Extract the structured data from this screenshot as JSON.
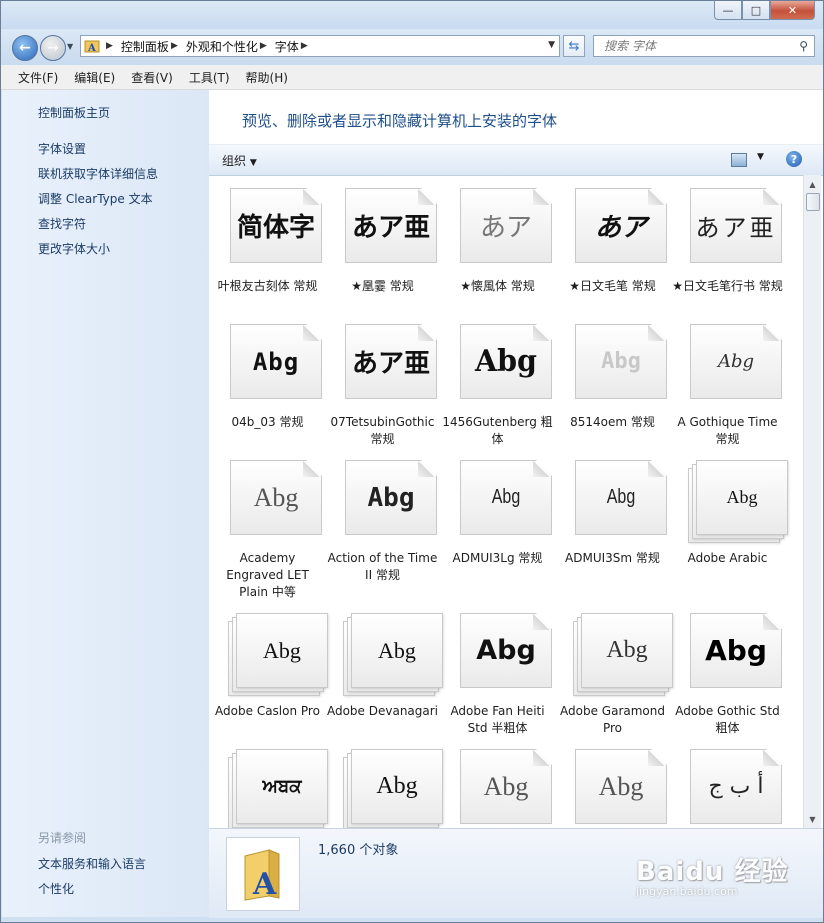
{
  "window": {
    "caption": {
      "minimize": "—",
      "maximize": "□",
      "close": "✕"
    }
  },
  "address": {
    "crumbs": [
      "控制面板",
      "外观和个性化",
      "字体"
    ],
    "search_placeholder": "搜索 字体"
  },
  "menu": [
    "文件(F)",
    "编辑(E)",
    "查看(V)",
    "工具(T)",
    "帮助(H)"
  ],
  "sidebar": {
    "home": "控制面板主页",
    "links": [
      "字体设置",
      "联机获取字体详细信息",
      "调整 ClearType 文本",
      "查找字符",
      "更改字体大小"
    ],
    "see_also_title": "另请参阅",
    "see_also": [
      "文本服务和输入语言",
      "个性化"
    ]
  },
  "main": {
    "title": "预览、删除或者显示和隐藏计算机上安装的字体",
    "organize": "组织"
  },
  "fonts": [
    {
      "sample": "简体字",
      "name": "叶根友古刻体 常规",
      "stacked": false
    },
    {
      "sample": "あア亜",
      "name": "★凰霎 常规",
      "stacked": false
    },
    {
      "sample": "あア",
      "name": "★懐風体 常规",
      "stacked": false
    },
    {
      "sample": "あア",
      "name": "★日文毛笔 常规",
      "stacked": false
    },
    {
      "sample": "あア亜",
      "name": "★日文毛笔行书 常规",
      "stacked": false
    },
    {
      "sample": "Abg",
      "name": "04b_03 常规",
      "stacked": false
    },
    {
      "sample": "あア亜",
      "name": "07TetsubinGothic 常规",
      "stacked": false
    },
    {
      "sample": "Abg",
      "name": "1456Gutenberg 粗体",
      "stacked": false
    },
    {
      "sample": "Abg",
      "name": "8514oem 常规",
      "stacked": false
    },
    {
      "sample": "Abg",
      "name": "A Gothique Time  常规",
      "stacked": false
    },
    {
      "sample": "Abg",
      "name": "Academy Engraved LET Plain 中等",
      "stacked": false
    },
    {
      "sample": "Abg",
      "name": "Action of the Time II 常规",
      "stacked": false
    },
    {
      "sample": "Abg",
      "name": "ADMUI3Lg 常规",
      "stacked": false
    },
    {
      "sample": "Abg",
      "name": "ADMUI3Sm 常规",
      "stacked": false
    },
    {
      "sample": "Abg",
      "name": "Adobe Arabic",
      "stacked": true
    },
    {
      "sample": "Abg",
      "name": "Adobe Caslon Pro",
      "stacked": true
    },
    {
      "sample": "Abg",
      "name": "Adobe Devanagari",
      "stacked": true
    },
    {
      "sample": "Abg",
      "name": "Adobe Fan Heiti Std 半粗体",
      "stacked": false
    },
    {
      "sample": "Abg",
      "name": "Adobe Garamond Pro",
      "stacked": true
    },
    {
      "sample": "Abg",
      "name": "Adobe Gothic Std 粗体",
      "stacked": false
    },
    {
      "sample": "ਅਬਕ",
      "name": "",
      "stacked": true
    },
    {
      "sample": "Abg",
      "name": "",
      "stacked": true
    },
    {
      "sample": "Abg",
      "name": "",
      "stacked": false
    },
    {
      "sample": "Abg",
      "name": "",
      "stacked": false
    },
    {
      "sample": "أ ب ج",
      "name": "",
      "stacked": false
    }
  ],
  "status": {
    "count": "1,660 个对象"
  },
  "watermark": {
    "main": "Baidu 经验",
    "sub": "jingyan.baidu.com"
  }
}
